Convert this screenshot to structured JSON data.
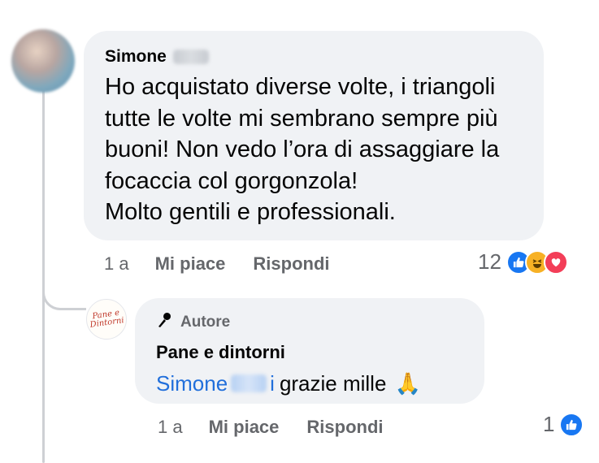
{
  "comment": {
    "author_first": "Simone",
    "text": "Ho acquistato diverse volte, i triangoli\ntutte le volte mi sembrano sempre più\nbuoni! Non vedo l’ora di assaggiare la\nfocaccia col gorgonzola!\nMolto gentili e professionali.",
    "time": "1 a",
    "like_label": "Mi piace",
    "reply_label": "Rispondi",
    "reaction_count": "12",
    "reactions": [
      "like-icon",
      "haha-icon",
      "love-icon"
    ]
  },
  "reply": {
    "badge_label": "Autore",
    "author": "Pane e dintorni",
    "logo_text_line1": "Pane e",
    "logo_text_line2": "Dintorni",
    "mention_first": "Simone",
    "mention_last_visible": "i",
    "text": "grazie mille",
    "emoji": "🙏",
    "time": "1 a",
    "like_label": "Mi piace",
    "reply_label": "Rispondi",
    "reaction_count": "1",
    "reactions": [
      "like-icon"
    ]
  },
  "colors": {
    "bubble": "#f0f2f5",
    "meta_text": "#65676b",
    "link_blue": "#216fdb",
    "like_blue": "#1877f2",
    "love_red": "#f33e58",
    "haha_yellow": "#f7b125"
  }
}
